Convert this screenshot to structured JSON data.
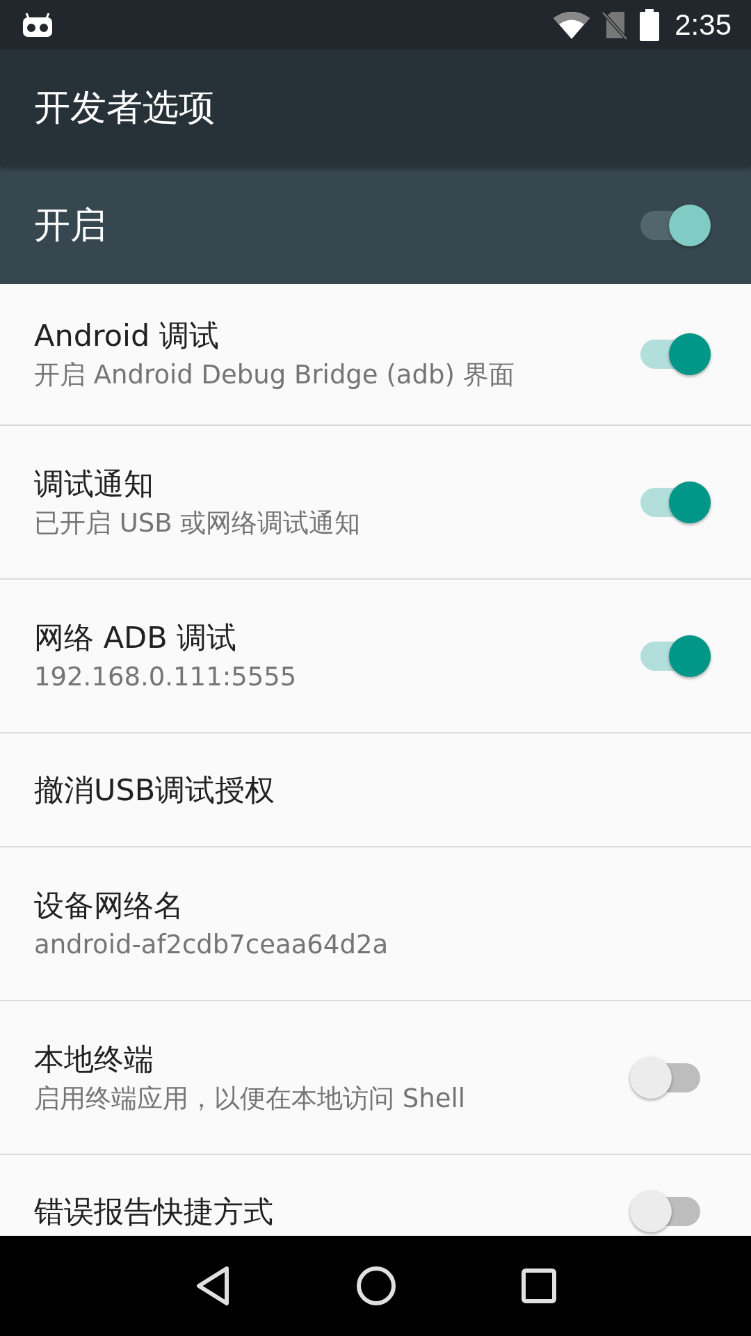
{
  "status_bar": {
    "time": "2:35"
  },
  "toolbar": {
    "title": "开发者选项"
  },
  "master_switch": {
    "label": "开启",
    "on": true
  },
  "settings": [
    {
      "kind": "switch",
      "title": "Android 调试",
      "summary": "开启 Android Debug Bridge (adb) 界面",
      "on": true
    },
    {
      "kind": "switch",
      "title": "调试通知",
      "summary": "已开启 USB 或网络调试通知",
      "on": true
    },
    {
      "kind": "switch",
      "title": "网络 ADB 调试",
      "summary": "192.168.0.111:5555",
      "on": true
    },
    {
      "kind": "plain",
      "title": "撤消USB调试授权"
    },
    {
      "kind": "plain",
      "title": "设备网络名",
      "summary": "android-af2cdb7ceaa64d2a"
    },
    {
      "kind": "switch",
      "title": "本地终端",
      "summary": "启用终端应用，以便在本地访问 Shell",
      "on": false
    },
    {
      "kind": "switch",
      "title": "错误报告快捷方式",
      "on": false
    }
  ]
}
